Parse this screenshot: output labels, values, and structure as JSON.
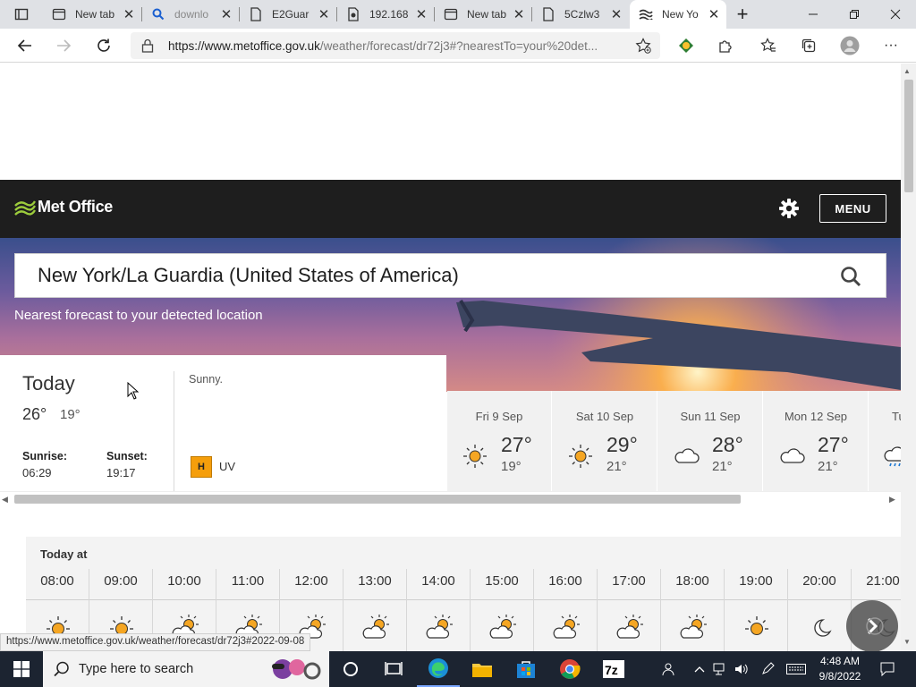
{
  "browser": {
    "tabs": [
      {
        "label": "New tab",
        "icon": "newtab-icon"
      },
      {
        "label": "downlo",
        "icon": "search-icon"
      },
      {
        "label": "E2Guar",
        "icon": "document-icon"
      },
      {
        "label": "192.168",
        "icon": "document-icon"
      },
      {
        "label": "New tab",
        "icon": "newtab-icon"
      },
      {
        "label": "5Czlw3",
        "icon": "document-icon"
      },
      {
        "label": "New Yo",
        "icon": "metoffice-icon",
        "active": true
      }
    ],
    "url_main": "https://www.metoffice.gov.uk",
    "url_rest": "/weather/forecast/dr72j3#?nearestTo=your%20det...",
    "new_tab_symbol": "+"
  },
  "header": {
    "logo_text": "Met Office",
    "menu_label": "MENU"
  },
  "search": {
    "value": "New York/La Guardia (United States of America)",
    "nearest_text": "Nearest forecast to your detected location"
  },
  "today": {
    "title": "Today",
    "high": "26°",
    "low": "19°",
    "sunrise_label": "Sunrise:",
    "sunrise_time": "06:29",
    "sunset_label": "Sunset:",
    "sunset_time": "19:17",
    "description": "Sunny.",
    "uv_badge": "H",
    "uv_label": "UV"
  },
  "days": [
    {
      "name": "Fri 9 Sep",
      "high": "27°",
      "low": "19°",
      "icon": "sun-icon"
    },
    {
      "name": "Sat 10 Sep",
      "high": "29°",
      "low": "21°",
      "icon": "sun-icon"
    },
    {
      "name": "Sun 11 Sep",
      "high": "28°",
      "low": "21°",
      "icon": "cloud-icon"
    },
    {
      "name": "Mon 12 Sep",
      "high": "27°",
      "low": "21°",
      "icon": "cloud-icon"
    },
    {
      "name": "Tu",
      "high": "",
      "low": "",
      "icon": "rain-cloud-icon"
    }
  ],
  "hourly": {
    "title": "Today at",
    "hours": [
      {
        "time": "08:00",
        "icon": "sun-icon"
      },
      {
        "time": "09:00",
        "icon": "sun-icon"
      },
      {
        "time": "10:00",
        "icon": "sun-cloud-icon"
      },
      {
        "time": "11:00",
        "icon": "sun-cloud-icon"
      },
      {
        "time": "12:00",
        "icon": "sun-cloud-icon"
      },
      {
        "time": "13:00",
        "icon": "sun-cloud-icon"
      },
      {
        "time": "14:00",
        "icon": "sun-cloud-icon"
      },
      {
        "time": "15:00",
        "icon": "sun-cloud-icon"
      },
      {
        "time": "16:00",
        "icon": "sun-cloud-icon"
      },
      {
        "time": "17:00",
        "icon": "sun-cloud-icon"
      },
      {
        "time": "18:00",
        "icon": "sun-cloud-icon"
      },
      {
        "time": "19:00",
        "icon": "sun-icon"
      },
      {
        "time": "20:00",
        "icon": "moon-icon"
      },
      {
        "time": "21:00",
        "icon": "moon-icon"
      }
    ]
  },
  "status_url": "https://www.metoffice.gov.uk/weather/forecast/dr72j3#2022-09-08",
  "taskbar": {
    "search_placeholder": "Type here to search",
    "time": "4:48 AM",
    "date": "9/8/2022"
  },
  "colors": {
    "header_bg": "#1e1e1e",
    "logo_green": "#9ccc3c",
    "uv_high": "#f59e0b",
    "sun_orange": "#f5a623",
    "taskbar_bg": "#1c2431"
  }
}
